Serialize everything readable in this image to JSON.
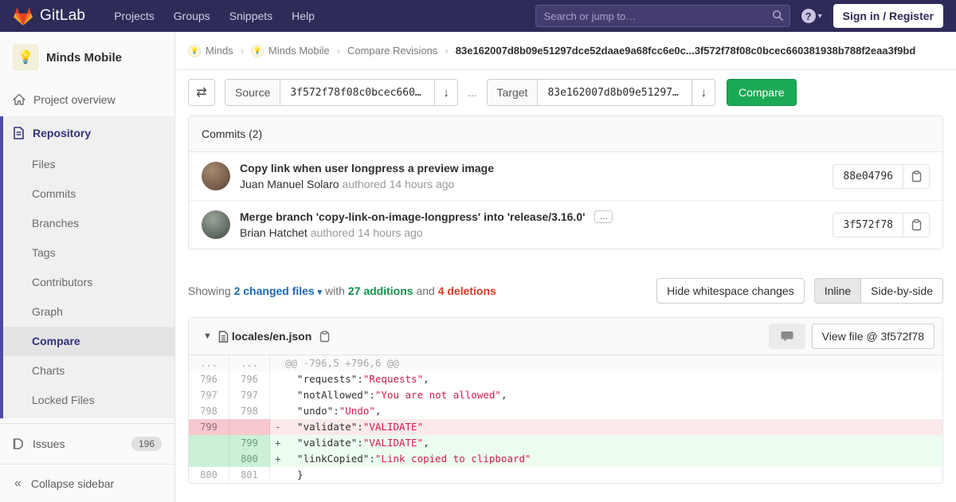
{
  "nav": {
    "logo_text": "GitLab",
    "items": [
      "Projects",
      "Groups",
      "Snippets",
      "Help"
    ],
    "search_placeholder": "Search or jump to…",
    "help_glyph": "?",
    "sign_in": "Sign in / Register"
  },
  "sidebar": {
    "project_title": "Minds Mobile",
    "avatar_glyph": "💡",
    "overview": "Project overview",
    "repository": {
      "label": "Repository",
      "items": [
        "Files",
        "Commits",
        "Branches",
        "Tags",
        "Contributors",
        "Graph",
        "Compare",
        "Charts",
        "Locked Files"
      ]
    },
    "issues": {
      "label": "Issues",
      "count": "196"
    },
    "collapse": "Collapse sidebar"
  },
  "breadcrumb": {
    "group": "Minds",
    "project": "Minds Mobile",
    "page": "Compare Revisions",
    "current": "83e162007d8b09e51297dce52daae9a68fcc6e0c...3f572f78f08c0bcec660381938b788f2eaa3f9bd"
  },
  "compare_form": {
    "source_label": "Source",
    "source_value": "3f572f78f08c0bcec660…",
    "separator": "...",
    "target_label": "Target",
    "target_value": "83e162007d8b09e51297…",
    "button": "Compare"
  },
  "commits": {
    "header": "Commits (2)",
    "items": [
      {
        "title": "Copy link when user longpress a preview image",
        "author": "Juan Manuel Solaro",
        "meta": "authored 14 hours ago",
        "hash": "88e04796"
      },
      {
        "title": "Merge branch 'copy-link-on-image-longpress' into 'release/3.16.0'",
        "author": "Brian Hatchet",
        "meta": "authored 14 hours ago",
        "hash": "3f572f78",
        "ellipsis": "…"
      }
    ]
  },
  "summary": {
    "showing": "Showing",
    "changed_files": "2 changed files",
    "with": "with",
    "additions": "27 additions",
    "and": "and",
    "deletions": "4 deletions",
    "hide_whitespace": "Hide whitespace changes",
    "inline": "Inline",
    "side_by_side": "Side-by-side"
  },
  "diff": {
    "file_name": "locales/en.json",
    "view_file": "View file @ 3f572f78",
    "lines": [
      {
        "old": "...",
        "new": "...",
        "m": "",
        "k": "@@ -796,5 +796,6 @@",
        "s": "",
        "p": ""
      },
      {
        "old": "796",
        "new": "796",
        "m": "",
        "k": "  \"requests\":",
        "s": "\"Requests\"",
        "p": ","
      },
      {
        "old": "797",
        "new": "797",
        "m": "",
        "k": "  \"notAllowed\":",
        "s": "\"You are not allowed\"",
        "p": ","
      },
      {
        "old": "798",
        "new": "798",
        "m": "",
        "k": "  \"undo\":",
        "s": "\"Undo\"",
        "p": ","
      },
      {
        "old": "799",
        "new": "",
        "m": "-",
        "k": "  \"validate\":",
        "s": "\"VALIDATE\"",
        "p": ""
      },
      {
        "old": "",
        "new": "799",
        "m": "+",
        "k": "  \"validate\":",
        "s": "\"VALIDATE\"",
        "p": ","
      },
      {
        "old": "",
        "new": "800",
        "m": "+",
        "k": "  \"linkCopied\":",
        "s": "\"Link copied to clipboard\"",
        "p": ""
      },
      {
        "old": "800",
        "new": "801",
        "m": "",
        "k": "  }",
        "s": "",
        "p": ""
      }
    ]
  }
}
